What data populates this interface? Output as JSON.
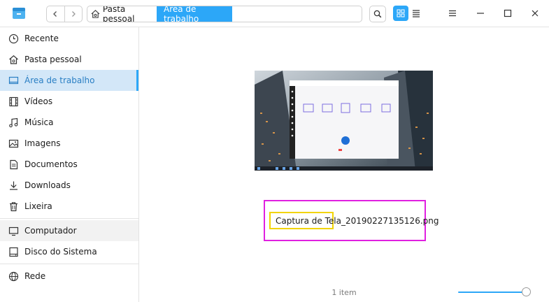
{
  "toolbar": {
    "breadcrumb": {
      "home_label": "Pasta pessoal",
      "current_label": "Área de trabalho"
    }
  },
  "sidebar": {
    "items": [
      {
        "label": "Recente",
        "icon": "clock-icon"
      },
      {
        "label": "Pasta pessoal",
        "icon": "home-icon"
      },
      {
        "label": "Área de trabalho",
        "icon": "desktop-icon"
      },
      {
        "label": "Vídeos",
        "icon": "film-icon"
      },
      {
        "label": "Música",
        "icon": "music-note-icon"
      },
      {
        "label": "Imagens",
        "icon": "image-icon"
      },
      {
        "label": "Documentos",
        "icon": "document-icon"
      },
      {
        "label": "Downloads",
        "icon": "download-icon"
      },
      {
        "label": "Lixeira",
        "icon": "trash-icon"
      }
    ],
    "computer": {
      "label": "Computador",
      "icon": "computer-icon"
    },
    "system_disk": {
      "label": "Disco do Sistema",
      "icon": "disk-icon"
    },
    "network": {
      "label": "Rede",
      "icon": "network-icon"
    }
  },
  "main": {
    "file": {
      "name": "Captura de Tela_20190227135126.png"
    },
    "status": {
      "item_count": "1 item"
    },
    "zoom_slider_value": 0.9
  },
  "colors": {
    "accent": "#2ca7f8",
    "selection_bg": "#d3e7f8",
    "magenta_highlight": "#e020e0",
    "yellow_highlight": "#f2d400"
  }
}
